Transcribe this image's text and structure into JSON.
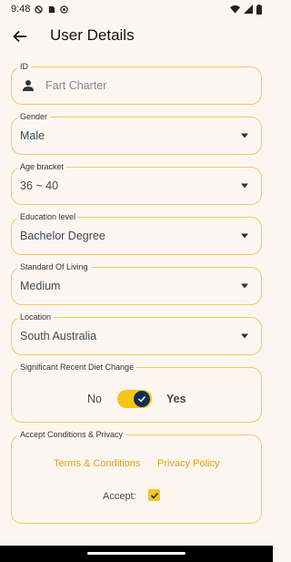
{
  "status_bar": {
    "time": "9:48"
  },
  "app_bar": {
    "title": "User Details"
  },
  "id_field": {
    "label": "ID",
    "placeholder": "Fart Charter"
  },
  "gender": {
    "label": "Gender",
    "value": "Male"
  },
  "age_bracket": {
    "label": "Age bracket",
    "value": "36 ~ 40"
  },
  "education": {
    "label": "Education level",
    "value": "Bachelor Degree"
  },
  "standard_of_living": {
    "label": "Standard Of Living",
    "value": "Medium"
  },
  "location": {
    "label": "Location",
    "value": "South Australia"
  },
  "diet_change": {
    "label": "Significant Recent Diet Change",
    "no_label": "No",
    "yes_label": "Yes",
    "on": true
  },
  "conditions": {
    "label": "Accept Conditions & Privacy",
    "terms_link": "Terms & Conditions",
    "privacy_link": "Privacy Policy",
    "accept_label": "Accept:",
    "accepted": true
  },
  "colors": {
    "accent": "#f5c518",
    "border": "#f3c866",
    "thumb": "#152e4e",
    "link": "#e0a11b",
    "background": "#fdf6f0"
  }
}
